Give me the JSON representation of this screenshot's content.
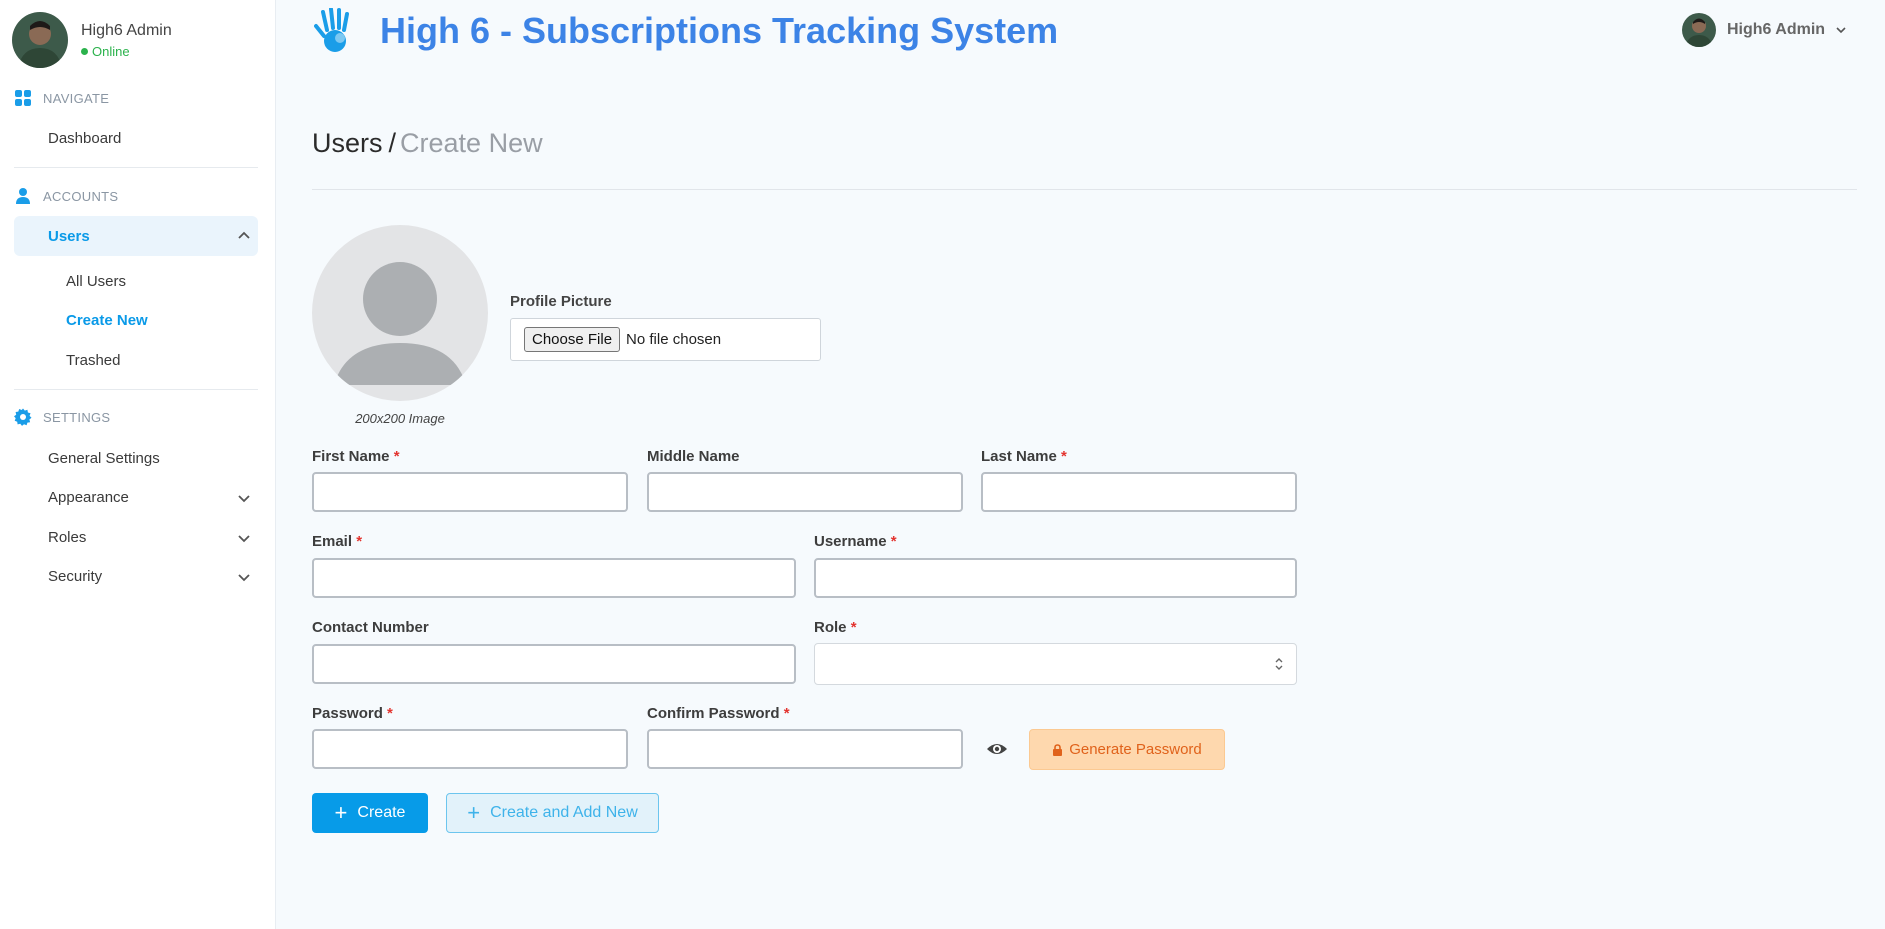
{
  "user": {
    "name": "High6 Admin",
    "status": "Online"
  },
  "sidebar": {
    "navigate": {
      "label": "NAVIGATE",
      "items": [
        {
          "label": "Dashboard"
        }
      ]
    },
    "accounts": {
      "label": "ACCOUNTS",
      "users_label": "Users",
      "sub_items": [
        {
          "label": "All Users"
        },
        {
          "label": "Create New"
        },
        {
          "label": "Trashed"
        }
      ]
    },
    "settings": {
      "label": "SETTINGS",
      "items": [
        {
          "label": "General Settings"
        },
        {
          "label": "Appearance"
        },
        {
          "label": "Roles"
        },
        {
          "label": "Security"
        }
      ]
    }
  },
  "header": {
    "title": "High 6 - Subscriptions Tracking System",
    "user_name": "High6 Admin"
  },
  "breadcrumb": {
    "parent": "Users",
    "separator": "/",
    "current": "Create New"
  },
  "profile": {
    "label": "Profile Picture",
    "caption": "200x200 Image",
    "choose_file": "Choose File",
    "file_status": "No file chosen"
  },
  "form": {
    "first_name": "First Name",
    "middle_name": "Middle Name",
    "last_name": "Last Name",
    "email": "Email",
    "username": "Username",
    "contact_number": "Contact Number",
    "role": "Role",
    "password": "Password",
    "confirm_password": "Confirm Password",
    "required_mark": "*"
  },
  "buttons": {
    "generate_password": "Generate Password",
    "create": "Create",
    "create_and_add": "Create and Add New"
  },
  "colors": {
    "accent": "#0a9ae8",
    "title": "#3c83e6",
    "warning_bg": "#fed8ae",
    "warning_text": "#e0621b",
    "online": "#2bb24c"
  }
}
